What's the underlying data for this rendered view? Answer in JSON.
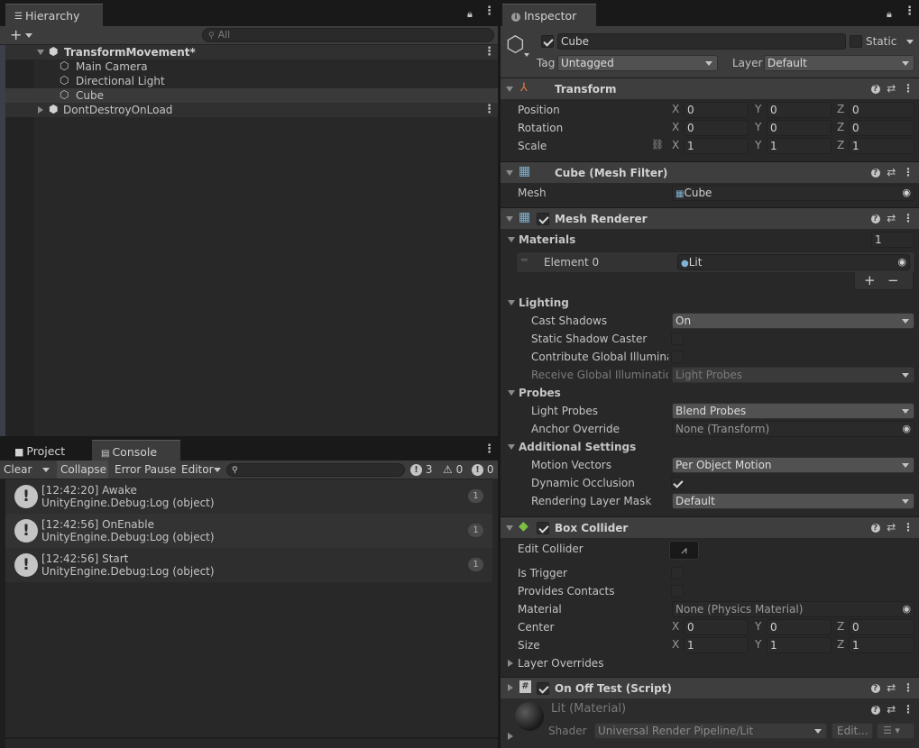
{
  "hierarchy": {
    "tab_label": "Hierarchy",
    "search_placeholder": "All",
    "scene_name": "TransformMovement*",
    "objects": [
      "Main Camera",
      "Directional Light",
      "Cube"
    ],
    "dontdestroy": "DontDestroyOnLoad"
  },
  "bottom": {
    "tab_project": "Project",
    "tab_console": "Console",
    "toolbar": {
      "clear": "Clear",
      "collapse": "Collapse",
      "error_pause": "Error Pause",
      "editor": "Editor"
    },
    "counts": {
      "messages": "3",
      "warnings": "0",
      "errors": "0"
    },
    "logs": [
      {
        "line1": "[12:42:20] Awake",
        "line2": "UnityEngine.Debug:Log (object)",
        "count": "1"
      },
      {
        "line1": "[12:42:56] OnEnable",
        "line2": "UnityEngine.Debug:Log (object)",
        "count": "1"
      },
      {
        "line1": "[12:42:56] Start",
        "line2": "UnityEngine.Debug:Log (object)",
        "count": "1"
      }
    ]
  },
  "inspector": {
    "tab_label": "Inspector",
    "object_name": "Cube",
    "static_label": "Static",
    "tag_label": "Tag",
    "tag_value": "Untagged",
    "layer_label": "Layer",
    "layer_value": "Default",
    "transform": {
      "title": "Transform",
      "position_label": "Position",
      "rotation_label": "Rotation",
      "scale_label": "Scale",
      "position": [
        "0",
        "0",
        "0"
      ],
      "rotation": [
        "0",
        "0",
        "0"
      ],
      "scale": [
        "1",
        "1",
        "1"
      ]
    },
    "mesh_filter": {
      "title": "Cube (Mesh Filter)",
      "mesh_label": "Mesh",
      "mesh_value": "Cube"
    },
    "mesh_renderer": {
      "title": "Mesh Renderer",
      "materials_label": "Materials",
      "materials_count": "1",
      "element_label": "Element 0",
      "element_value": "Lit",
      "lighting_label": "Lighting",
      "cast_shadows_label": "Cast Shadows",
      "cast_shadows_value": "On",
      "static_shadow_label": "Static Shadow Caster",
      "contribute_gi_label": "Contribute Global Illuminati",
      "receive_gi_label": "Receive Global Illumination",
      "receive_gi_value": "Light Probes",
      "probes_label": "Probes",
      "light_probes_label": "Light Probes",
      "light_probes_value": "Blend Probes",
      "anchor_label": "Anchor Override",
      "anchor_value": "None (Transform)",
      "additional_label": "Additional Settings",
      "motion_label": "Motion Vectors",
      "motion_value": "Per Object Motion",
      "occlusion_label": "Dynamic Occlusion",
      "rendering_mask_label": "Rendering Layer Mask",
      "rendering_mask_value": "Default"
    },
    "box_collider": {
      "title": "Box Collider",
      "edit_label": "Edit Collider",
      "trigger_label": "Is Trigger",
      "contacts_label": "Provides Contacts",
      "material_label": "Material",
      "material_value": "None (Physics Material)",
      "center_label": "Center",
      "size_label": "Size",
      "center": [
        "0",
        "0",
        "0"
      ],
      "size": [
        "1",
        "1",
        "1"
      ],
      "overrides_label": "Layer Overrides"
    },
    "script": {
      "title": "On Off Test (Script)"
    },
    "material": {
      "title": "Lit (Material)",
      "shader_label": "Shader",
      "shader_value": "Universal Render Pipeline/Lit",
      "edit_label": "Edit..."
    },
    "axes": [
      "X",
      "Y",
      "Z"
    ]
  }
}
